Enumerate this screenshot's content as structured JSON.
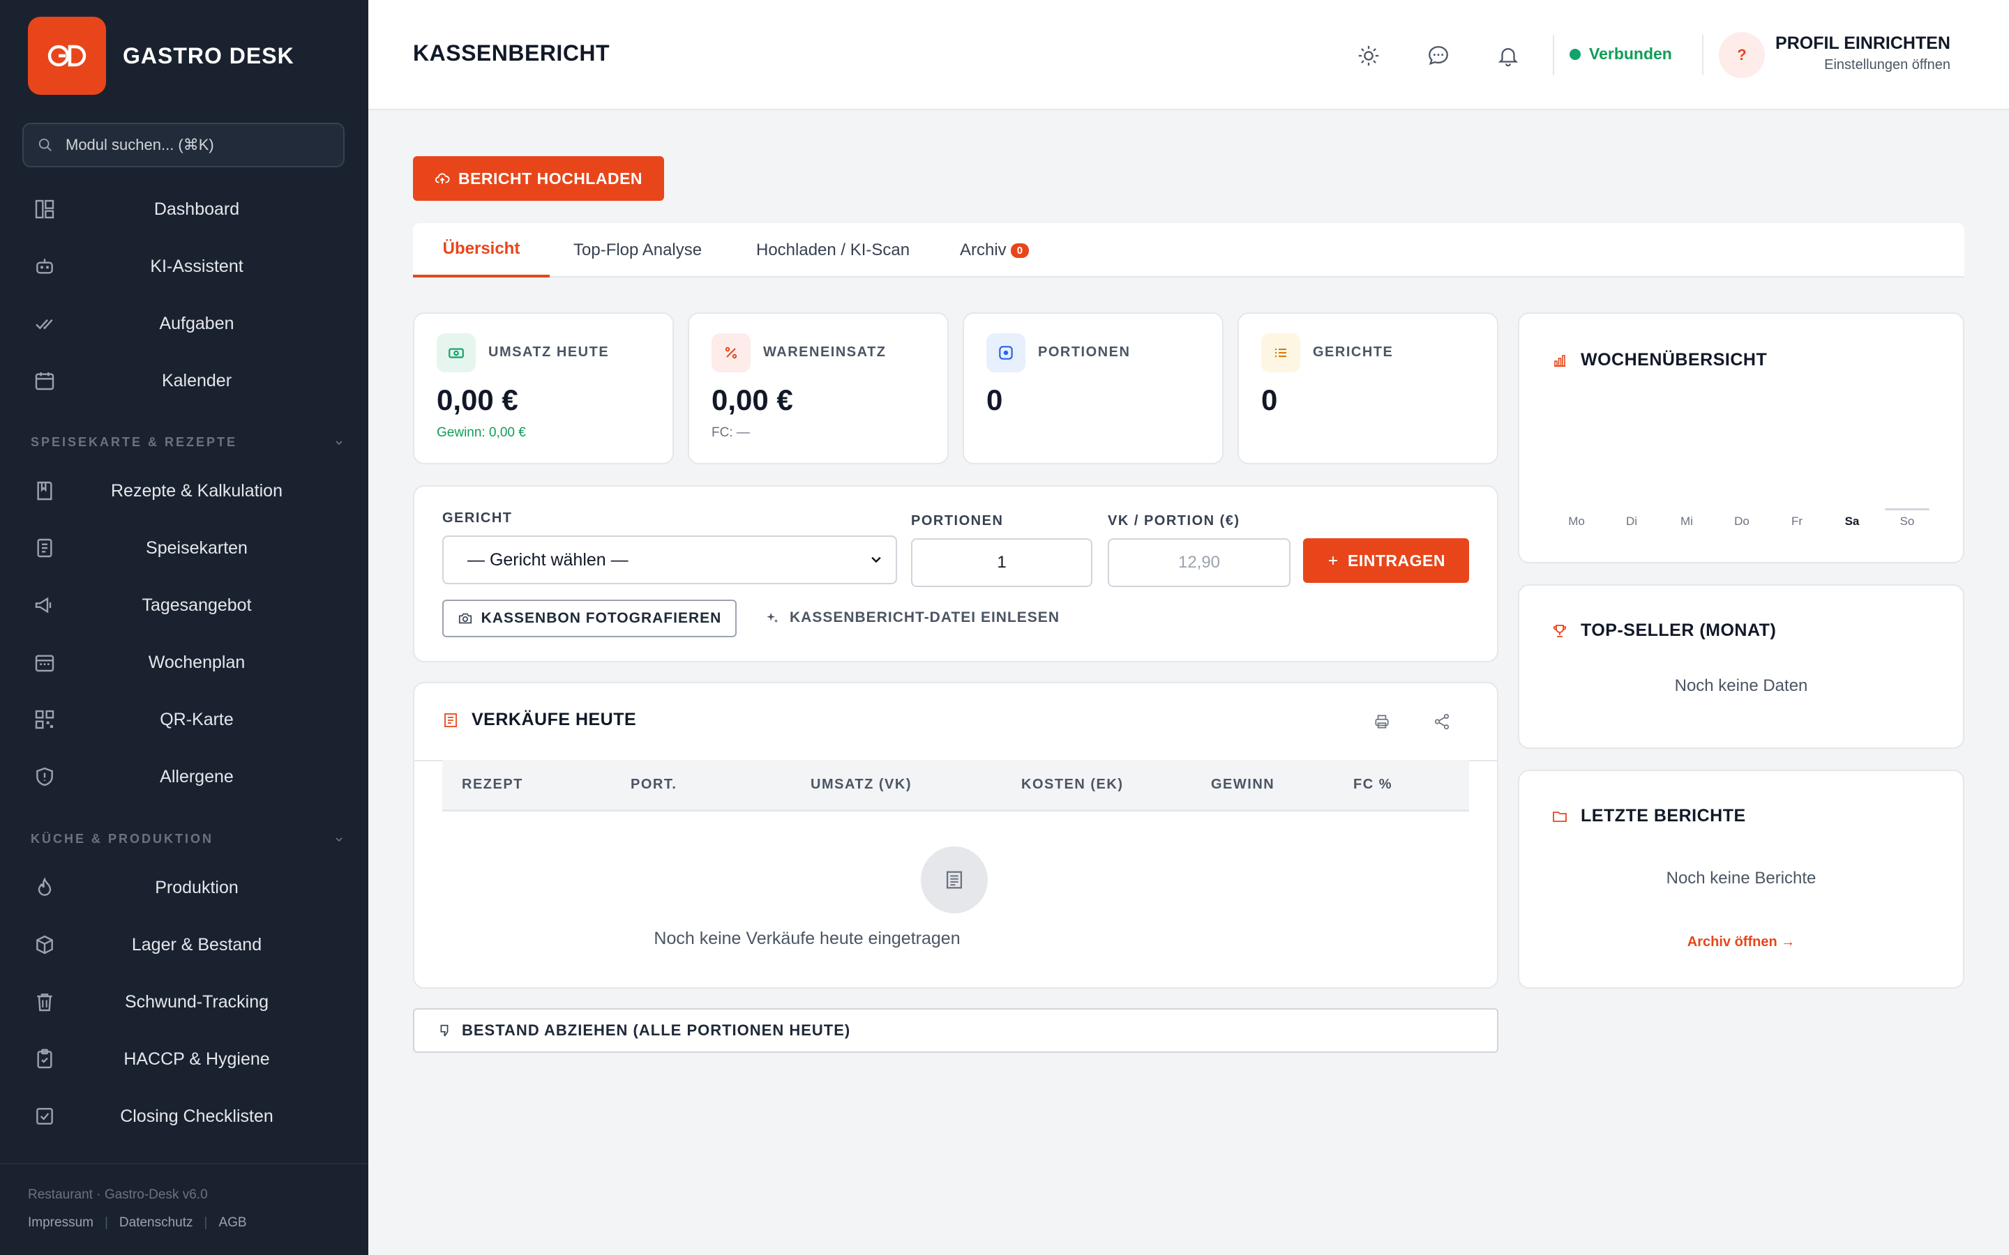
{
  "app": {
    "brand_name": "GASTRO DESK",
    "logo_text": "GD"
  },
  "colors": {
    "accent": "#e8461a",
    "sidebar_bg": "#1a2230",
    "success": "#10a36a"
  },
  "sidebar": {
    "search_placeholder": "Modul suchen... (⌘K)",
    "items_top": [
      {
        "label": "Dashboard",
        "icon": "dashboard-icon"
      },
      {
        "label": "KI-Assistent",
        "icon": "robot-icon"
      },
      {
        "label": "Aufgaben",
        "icon": "check-double-icon"
      },
      {
        "label": "Kalender",
        "icon": "calendar-icon"
      }
    ],
    "section_menu": "SPEISEKARTE & REZEPTE",
    "items_menu": [
      {
        "label": "Rezepte & Kalkulation",
        "icon": "recipe-book-icon"
      },
      {
        "label": "Speisekarten",
        "icon": "menu-card-icon"
      },
      {
        "label": "Tagesangebot",
        "icon": "megaphone-icon"
      },
      {
        "label": "Wochenplan",
        "icon": "calendar-week-icon"
      },
      {
        "label": "QR-Karte",
        "icon": "qr-code-icon"
      },
      {
        "label": "Allergene",
        "icon": "shield-icon"
      }
    ],
    "section_kitchen": "KÜCHE & PRODUKTION",
    "items_kitchen": [
      {
        "label": "Produktion",
        "icon": "flame-icon"
      },
      {
        "label": "Lager & Bestand",
        "icon": "box-icon"
      },
      {
        "label": "Schwund-Tracking",
        "icon": "trash-icon"
      },
      {
        "label": "HACCP & Hygiene",
        "icon": "clipboard-icon"
      },
      {
        "label": "Closing Checklisten",
        "icon": "checkbox-icon"
      }
    ],
    "footer_version": "Restaurant · Gastro-Desk v6.0",
    "footer_links": [
      "Impressum",
      "Datenschutz",
      "AGB"
    ]
  },
  "header": {
    "title": "KASSENBERICHT",
    "status": "Verbunden",
    "profile_initial": "?",
    "profile_title": "PROFIL EINRICHTEN",
    "profile_sub": "Einstellungen öffnen"
  },
  "main": {
    "upload_button": "BERICHT HOCHLADEN",
    "tabs": [
      {
        "label": "Übersicht"
      },
      {
        "label": "Top-Flop Analyse"
      },
      {
        "label": "Hochladen / KI-Scan"
      },
      {
        "label": "Archiv",
        "badge": "0"
      }
    ],
    "kpis": [
      {
        "label": "UMSATZ HEUTE",
        "value": "0,00 €",
        "sub": "Gewinn: 0,00 €",
        "icon": "cash-icon"
      },
      {
        "label": "WARENEINSATZ",
        "value": "0,00 €",
        "sub": "FC: —",
        "icon": "percent-icon"
      },
      {
        "label": "PORTIONEN",
        "value": "0",
        "sub": "",
        "icon": "plate-icon"
      },
      {
        "label": "GERICHTE",
        "value": "0",
        "sub": "",
        "icon": "list-icon"
      }
    ],
    "form": {
      "dish_label": "GERICHT",
      "dish_value": "— Gericht wählen —",
      "portions_label": "PORTIONEN",
      "portions_value": "1",
      "price_label": "VK / PORTION (€)",
      "price_placeholder": "12,90",
      "enter_button": "EINTRAGEN",
      "photo_button": "KASSENBON FOTOGRAFIEREN",
      "file_link": "KASSENBERICHT-DATEI EINLESEN"
    },
    "sales": {
      "title": "VERKÄUFE HEUTE",
      "columns": [
        "REZEPT",
        "PORT.",
        "UMSATZ (VK)",
        "KOSTEN (EK)",
        "GEWINN",
        "FC %"
      ],
      "empty": "Noch keine Verkäufe heute eingetragen"
    },
    "deduct_button": "BESTAND ABZIEHEN (ALLE PORTIONEN HEUTE)"
  },
  "right": {
    "week_title": "WOCHENÜBERSICHT",
    "days": [
      "Mo",
      "Di",
      "Mi",
      "Do",
      "Fr",
      "Sa",
      "So"
    ],
    "today": "Sa",
    "week_values": [
      0,
      0,
      0,
      0,
      0,
      0,
      0
    ],
    "top_title": "TOP-SELLER (MONAT)",
    "top_empty": "Noch keine Daten",
    "reports_title": "LETZTE BERICHTE",
    "reports_empty": "Noch keine Berichte",
    "archive_link": "Archiv öffnen →"
  }
}
